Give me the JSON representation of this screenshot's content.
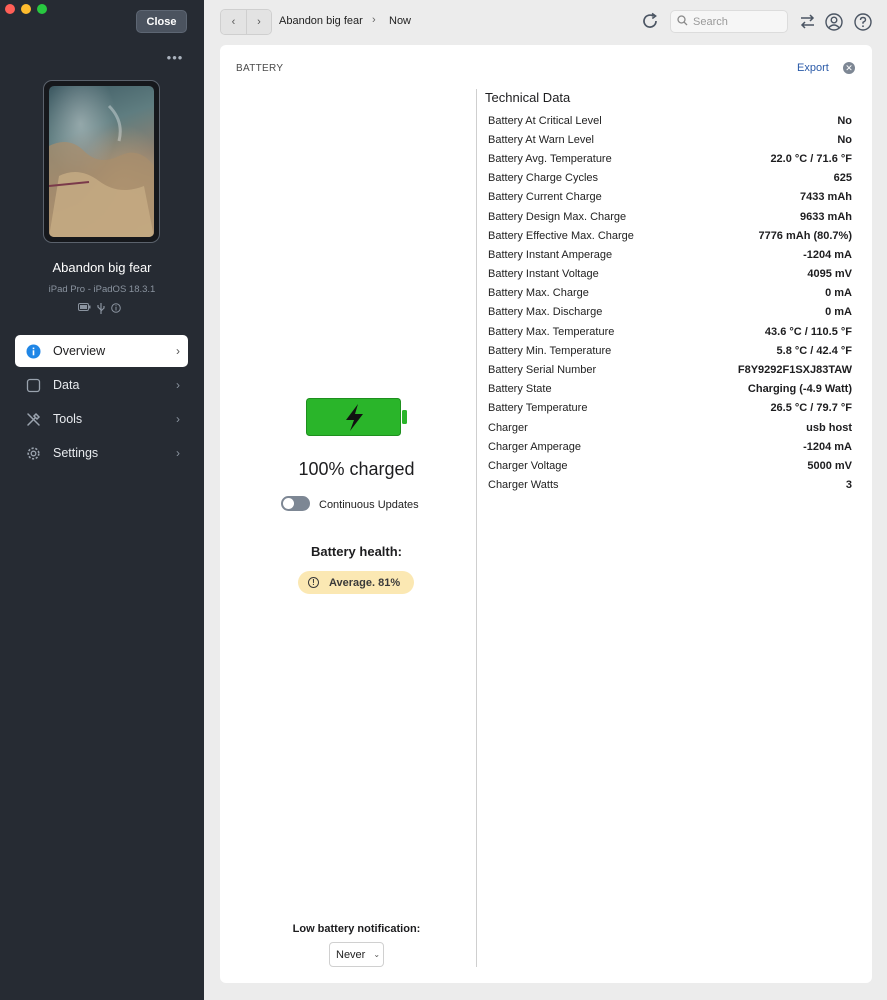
{
  "sidebar": {
    "close_label": "Close",
    "more_label": "•••",
    "device_name": "Abandon big fear",
    "device_subtitle": "iPad Pro - iPadOS 18.3.1",
    "nav": [
      {
        "label": "Overview",
        "icon": "info-icon",
        "active": true
      },
      {
        "label": "Data",
        "icon": "square-icon",
        "active": false
      },
      {
        "label": "Tools",
        "icon": "tools-icon",
        "active": false
      },
      {
        "label": "Settings",
        "icon": "gear-icon",
        "active": false
      }
    ]
  },
  "topbar": {
    "breadcrumb_device": "Abandon big fear",
    "breadcrumb_current": "Now",
    "search_placeholder": "Search"
  },
  "panel": {
    "section_title": "BATTERY",
    "export_label": "Export",
    "charge_text": "100% charged",
    "charge_level": 1.0,
    "continuous_updates_label": "Continuous Updates",
    "continuous_updates_on": false,
    "health_title": "Battery health:",
    "health_badge": "Average. 81%",
    "notification_label": "Low battery notification:",
    "notification_value": "Never"
  },
  "technical": {
    "title": "Technical Data",
    "rows": [
      {
        "key": "Battery At Critical Level",
        "value": "No"
      },
      {
        "key": "Battery At Warn Level",
        "value": "No"
      },
      {
        "key": "Battery Avg. Temperature",
        "value": "22.0 °C / 71.6 °F"
      },
      {
        "key": "Battery Charge Cycles",
        "value": "625"
      },
      {
        "key": "Battery Current Charge",
        "value": "7433 mAh"
      },
      {
        "key": "Battery Design Max. Charge",
        "value": "9633 mAh"
      },
      {
        "key": "Battery Effective Max. Charge",
        "value": "7776 mAh (80.7%)"
      },
      {
        "key": "Battery Instant Amperage",
        "value": "-1204 mA"
      },
      {
        "key": "Battery Instant Voltage",
        "value": "4095 mV"
      },
      {
        "key": "Battery Max. Charge",
        "value": "0 mA"
      },
      {
        "key": "Battery Max. Discharge",
        "value": "0 mA"
      },
      {
        "key": "Battery Max. Temperature",
        "value": "43.6 °C / 110.5 °F"
      },
      {
        "key": "Battery Min. Temperature",
        "value": "5.8 °C / 42.4 °F"
      },
      {
        "key": "Battery Serial Number",
        "value": "F8Y9292F1SXJ83TAW"
      },
      {
        "key": "Battery State",
        "value": "Charging (-4.9 Watt)"
      },
      {
        "key": "Battery Temperature",
        "value": "26.5 °C / 79.7 °F"
      },
      {
        "key": "Charger",
        "value": "usb host"
      },
      {
        "key": "Charger Amperage",
        "value": "-1204 mA"
      },
      {
        "key": "Charger Voltage",
        "value": "5000 mV"
      },
      {
        "key": "Charger Watts",
        "value": "3"
      }
    ]
  },
  "colors": {
    "sidebar_bg": "#262b33",
    "battery_green": "#2ab52a",
    "accent_blue": "#2a5aa8",
    "health_badge_bg": "#fbe8b3"
  }
}
